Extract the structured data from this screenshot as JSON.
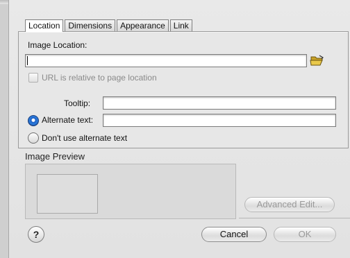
{
  "tabs": [
    "Location",
    "Dimensions",
    "Appearance",
    "Link"
  ],
  "active_tab": "Location",
  "image_location": {
    "label": "Image Location:",
    "value": ""
  },
  "url_relative": {
    "label": "URL is relative to page location",
    "checked": false,
    "enabled": false
  },
  "tooltip": {
    "label": "Tooltip:",
    "value": ""
  },
  "alternate_text": {
    "label": "Alternate text:",
    "value": "",
    "selected": true
  },
  "no_alternate_text": {
    "label": "Don't use alternate text",
    "selected": false
  },
  "image_preview": {
    "title": "Image Preview"
  },
  "buttons": {
    "advanced_edit": "Advanced Edit...",
    "cancel": "Cancel",
    "ok": "OK",
    "help": "?"
  },
  "icons": {
    "folder": "open-folder-icon"
  }
}
